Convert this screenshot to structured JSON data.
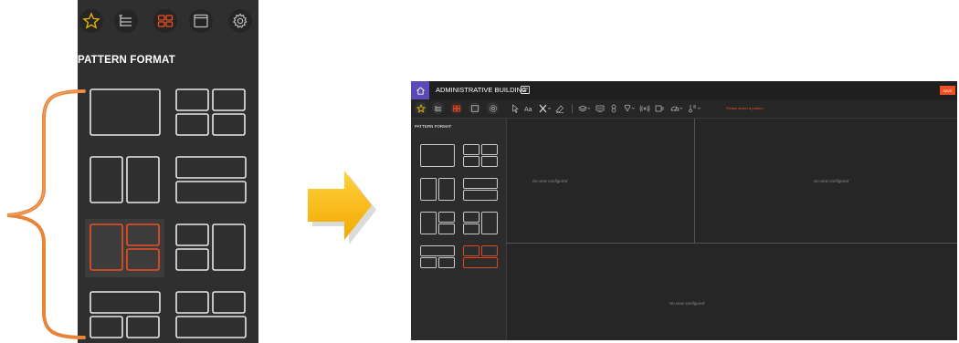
{
  "zoom_panel": {
    "title": "PATTERN FORMAT",
    "tabs": [
      "favorites-icon",
      "list-icon",
      "layout-icon",
      "window-icon",
      "settings-icon"
    ]
  },
  "app": {
    "title": "ADMINISTRATIVE BUILDING",
    "save_label": "SAVE",
    "toolbar_warning": "Please select a pattern",
    "sidebar_title": "PATTERN FORMAT",
    "panes": {
      "top_left": "No view configured",
      "top_right": "No view configured",
      "bottom": "No view configured"
    }
  },
  "colors": {
    "accent": "#f04e23",
    "home": "#5b49b7",
    "arrow": "#f7b500",
    "brace": "#e8833a",
    "star": "#e6b100"
  }
}
